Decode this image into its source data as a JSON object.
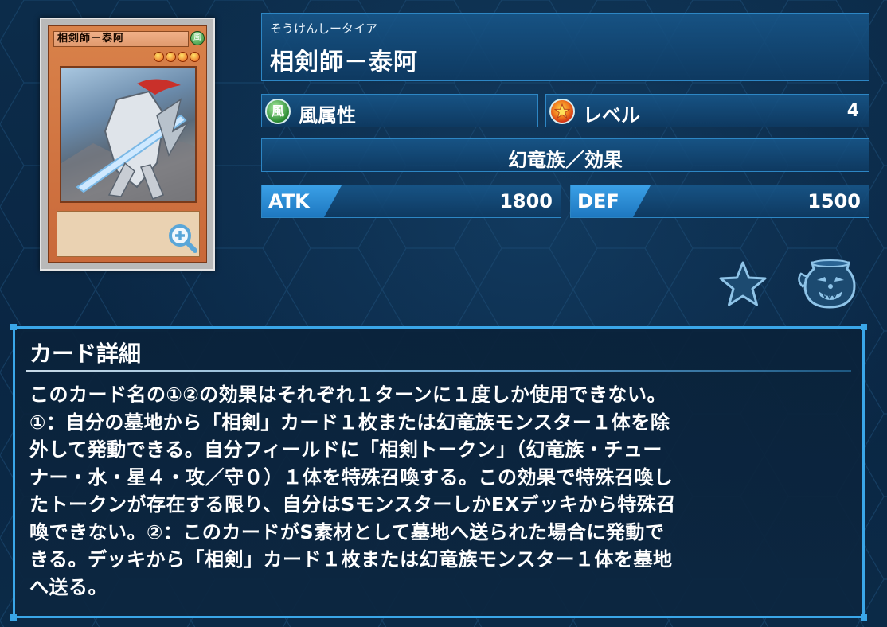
{
  "card": {
    "reading": "そうけんしータイア",
    "name": "相剣師－泰阿",
    "image": {
      "name_text": "相剣師－泰阿",
      "attribute_glyph": "風",
      "level": 4
    }
  },
  "attribute": {
    "icon": "wind-attribute-icon",
    "icon_glyph": "風",
    "label": "風属性"
  },
  "level": {
    "icon": "level-star-icon",
    "label": "レベル",
    "value": "4"
  },
  "type_line": "幻竜族／効果",
  "stats": {
    "atk_label": "ATK",
    "atk_value": "1800",
    "def_label": "DEF",
    "def_value": "1500"
  },
  "actions": {
    "favorite_icon": "star-icon",
    "pot_icon": "pot-of-greed-icon",
    "zoom_icon": "magnifier-plus-icon"
  },
  "detail": {
    "title": "カード詳細",
    "text": "このカード名の①②の効果はそれぞれ１ターンに１度しか使用できない。\n①：自分の墓地から「相剣」カード１枚または幻竜族モンスター１体を除\n外して発動できる。自分フィールドに「相剣トークン」（幻竜族・チュー\nナー・水・星４・攻／守０）１体を特殊召喚する。この効果で特殊召喚し\nたトークンが存在する限り、自分はSモンスターしかEXデッキから特殊召\n喚できない。②：このカードがS素材として墓地へ送られた場合に発動で\nきる。デッキから「相剣」カード１枚または幻竜族モンスター１体を墓地\nへ送る。"
  },
  "colors": {
    "background": "#0b2a47",
    "panel": "#17588c",
    "accent": "#3aa6e8",
    "card_orange": "#d9824a"
  }
}
